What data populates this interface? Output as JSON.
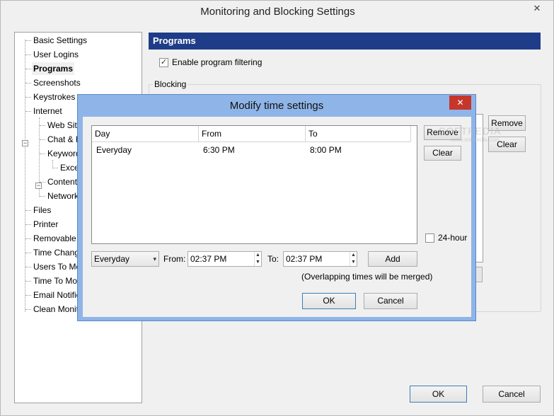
{
  "window": {
    "title": "Monitoring and Blocking Settings",
    "close_glyph": "✕"
  },
  "tree": {
    "items": [
      "Basic Settings",
      "User Logins",
      "Programs",
      "Screenshots",
      "Keystrokes",
      "Internet",
      "Web Sites",
      "Chat & E-",
      "Keywords",
      "Excep",
      "Content T",
      "Network",
      "Files",
      "Printer",
      "Removable De",
      "Time Changes",
      "Users To Moni",
      "Time To Monit",
      "Email Notificat",
      "Clean Monitor"
    ],
    "expand_glyph": "−"
  },
  "pane": {
    "header": "Programs",
    "enable_filtering": "Enable program filtering",
    "group_label": "Blocking",
    "remove_label": "Remove",
    "clear_label": "Clear"
  },
  "dialog": {
    "title": "Modify time settings",
    "close_glyph": "✕",
    "columns": [
      "Day",
      "From",
      "To"
    ],
    "rows": [
      {
        "day": "Everyday",
        "from": "6:30 PM",
        "to": "8:00 PM"
      }
    ],
    "remove_label": "Remove",
    "clear_label": "Clear",
    "hour24_label": "24-hour",
    "day_select": "Everyday",
    "from_label": "From:",
    "from_value": "02:37 PM",
    "to_label": "To:",
    "to_value": "02:37 PM",
    "add_label": "Add",
    "note": "(Overlapping times will be merged)",
    "ok_label": "OK",
    "cancel_label": "Cancel"
  },
  "footer": {
    "ok_label": "OK",
    "cancel_label": "Cancel"
  },
  "watermark": {
    "text": "SOFTPEDIA",
    "sub": "www.softpedia.com"
  },
  "glyphs": {
    "check": "✓",
    "dropdown": "▾",
    "up": "▲",
    "down": "▼"
  }
}
